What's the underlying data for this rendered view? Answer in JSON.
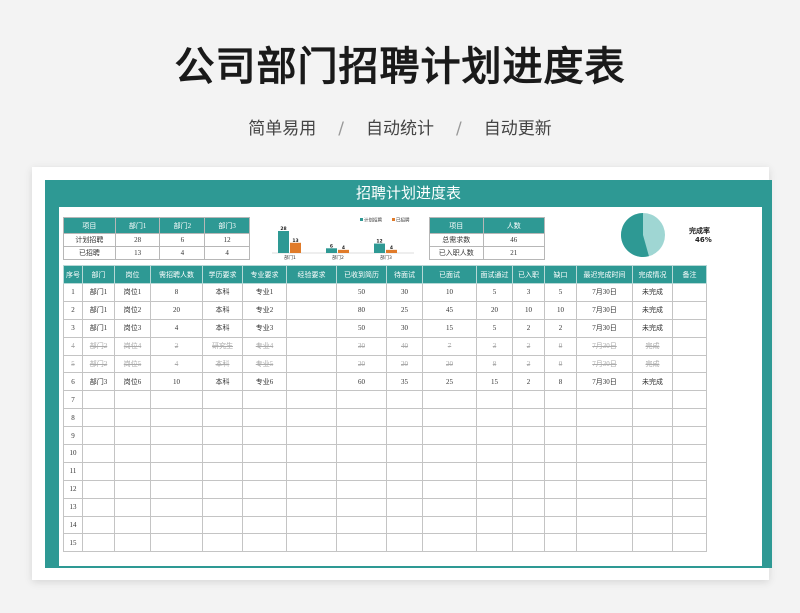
{
  "page": {
    "title": "公司部门招聘计划进度表",
    "subtitle_items": [
      "简单易用",
      "自动统计",
      "自动更新"
    ],
    "subtitle_sep": "/"
  },
  "sheet": {
    "title": "招聘计划进度表",
    "accent": "#2e9994"
  },
  "summary": {
    "headers": [
      "项目",
      "部门1",
      "部门2",
      "部门3"
    ],
    "rows": [
      [
        "计划招聘",
        "28",
        "6",
        "12"
      ],
      [
        "已招聘",
        "13",
        "4",
        "4"
      ]
    ]
  },
  "totals": {
    "headers": [
      "项目",
      "人数"
    ],
    "rows": [
      [
        "总需求数",
        "46"
      ],
      [
        "已入职人数",
        "21"
      ]
    ]
  },
  "chart_data": {
    "type": "bar",
    "categories": [
      "部门1",
      "部门2",
      "部门3"
    ],
    "series": [
      {
        "name": "计划招聘",
        "values": [
          28,
          6,
          12
        ],
        "color": "#2e9994"
      },
      {
        "name": "已招聘",
        "values": [
          13,
          4,
          4
        ],
        "color": "#e07b2a"
      }
    ],
    "ylim": [
      0,
      28
    ],
    "legend": "top-right"
  },
  "pie": {
    "label": "完成率",
    "value_text": "46%",
    "fraction": 0.4565,
    "color_done": "#2e9994",
    "color_rest": "#9fd6d3"
  },
  "main": {
    "headers": [
      "序号",
      "部门",
      "岗位",
      "需招聘人数",
      "学历要求",
      "专业要求",
      "经验要求",
      "已收到简历",
      "待面试",
      "已面试",
      "面试通过",
      "已入职",
      "缺口",
      "最迟完成时间",
      "完成情况",
      "备注"
    ],
    "rows": [
      {
        "cells": [
          "1",
          "部门1",
          "岗位1",
          "8",
          "本科",
          "专业1",
          "",
          "50",
          "30",
          "10",
          "5",
          "3",
          "5",
          "7月30日",
          "未完成",
          ""
        ],
        "struck": false
      },
      {
        "cells": [
          "2",
          "部门1",
          "岗位2",
          "20",
          "本科",
          "专业2",
          "",
          "80",
          "25",
          "45",
          "20",
          "10",
          "10",
          "7月30日",
          "未完成",
          ""
        ],
        "struck": false
      },
      {
        "cells": [
          "3",
          "部门1",
          "岗位3",
          "4",
          "本科",
          "专业3",
          "",
          "50",
          "30",
          "15",
          "5",
          "2",
          "2",
          "7月30日",
          "未完成",
          ""
        ],
        "struck": false
      },
      {
        "cells": [
          "4",
          "部门2",
          "岗位4",
          "2",
          "研究生",
          "专业4",
          "",
          "30",
          "40",
          "7",
          "3",
          "2",
          "0",
          "7月30日",
          "完成",
          ""
        ],
        "struck": true
      },
      {
        "cells": [
          "5",
          "部门2",
          "岗位5",
          "4",
          "本科",
          "专业5",
          "",
          "20",
          "20",
          "20",
          "8",
          "2",
          "0",
          "7月30日",
          "完成",
          ""
        ],
        "struck": true
      },
      {
        "cells": [
          "6",
          "部门3",
          "岗位6",
          "10",
          "本科",
          "专业6",
          "",
          "60",
          "35",
          "25",
          "15",
          "2",
          "8",
          "7月30日",
          "未完成",
          ""
        ],
        "struck": false
      },
      {
        "cells": [
          "7",
          "",
          "",
          "",
          "",
          "",
          "",
          "",
          "",
          "",
          "",
          "",
          "",
          "",
          "",
          ""
        ],
        "struck": false
      },
      {
        "cells": [
          "8",
          "",
          "",
          "",
          "",
          "",
          "",
          "",
          "",
          "",
          "",
          "",
          "",
          "",
          "",
          ""
        ],
        "struck": false
      },
      {
        "cells": [
          "9",
          "",
          "",
          "",
          "",
          "",
          "",
          "",
          "",
          "",
          "",
          "",
          "",
          "",
          "",
          ""
        ],
        "struck": false
      },
      {
        "cells": [
          "10",
          "",
          "",
          "",
          "",
          "",
          "",
          "",
          "",
          "",
          "",
          "",
          "",
          "",
          "",
          ""
        ],
        "struck": false
      },
      {
        "cells": [
          "11",
          "",
          "",
          "",
          "",
          "",
          "",
          "",
          "",
          "",
          "",
          "",
          "",
          "",
          "",
          ""
        ],
        "struck": false
      },
      {
        "cells": [
          "12",
          "",
          "",
          "",
          "",
          "",
          "",
          "",
          "",
          "",
          "",
          "",
          "",
          "",
          "",
          ""
        ],
        "struck": false
      },
      {
        "cells": [
          "13",
          "",
          "",
          "",
          "",
          "",
          "",
          "",
          "",
          "",
          "",
          "",
          "",
          "",
          "",
          ""
        ],
        "struck": false
      },
      {
        "cells": [
          "14",
          "",
          "",
          "",
          "",
          "",
          "",
          "",
          "",
          "",
          "",
          "",
          "",
          "",
          "",
          ""
        ],
        "struck": false
      },
      {
        "cells": [
          "15",
          "",
          "",
          "",
          "",
          "",
          "",
          "",
          "",
          "",
          "",
          "",
          "",
          "",
          "",
          ""
        ],
        "struck": false
      }
    ]
  }
}
